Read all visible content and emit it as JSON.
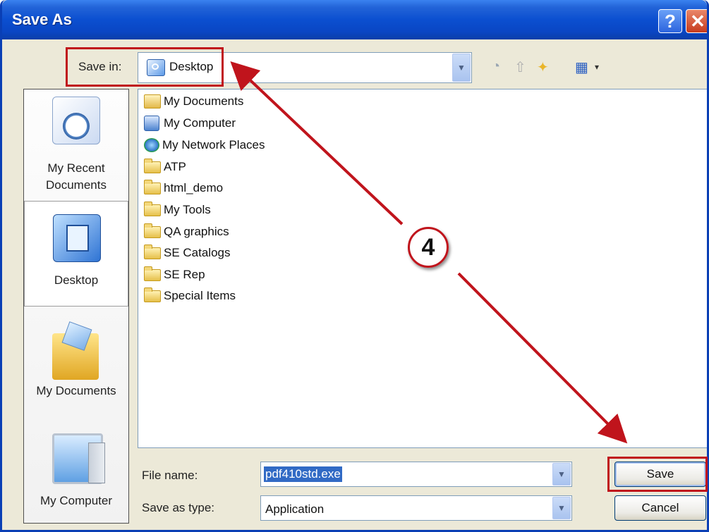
{
  "window": {
    "title": "Save As",
    "help_label": "?",
    "close_label": "✕"
  },
  "toolbar": {
    "save_in_label": "Save in:",
    "save_in_value": "Desktop",
    "icons": [
      "back-icon",
      "up-folder-icon",
      "new-folder-icon",
      "views-menu-icon"
    ]
  },
  "places": [
    {
      "label": "My Recent Documents",
      "icon": "recent-documents-icon"
    },
    {
      "label": "Desktop",
      "icon": "desktop-icon",
      "selected": true
    },
    {
      "label": "My Documents",
      "icon": "my-documents-icon"
    },
    {
      "label": "My Computer",
      "icon": "my-computer-icon"
    }
  ],
  "files": [
    {
      "name": "My Documents",
      "icon": "my-documents-icon"
    },
    {
      "name": "My Computer",
      "icon": "my-computer-icon"
    },
    {
      "name": "My Network Places",
      "icon": "network-places-icon"
    },
    {
      "name": "ATP",
      "icon": "folder-icon"
    },
    {
      "name": "html_demo",
      "icon": "folder-icon"
    },
    {
      "name": "My Tools",
      "icon": "folder-icon"
    },
    {
      "name": "QA graphics",
      "icon": "folder-icon"
    },
    {
      "name": "SE Catalogs",
      "icon": "folder-icon"
    },
    {
      "name": "SE Rep",
      "icon": "folder-icon"
    },
    {
      "name": "Special Items",
      "icon": "folder-icon"
    }
  ],
  "form": {
    "file_name_label": "File name:",
    "file_name_value": "pdf410std.exe",
    "save_as_type_label": "Save as type:",
    "save_as_type_value": "Application"
  },
  "buttons": {
    "save": "Save",
    "cancel": "Cancel"
  },
  "annotation": {
    "step_number": "4",
    "highlight_color": "#c0141c"
  }
}
